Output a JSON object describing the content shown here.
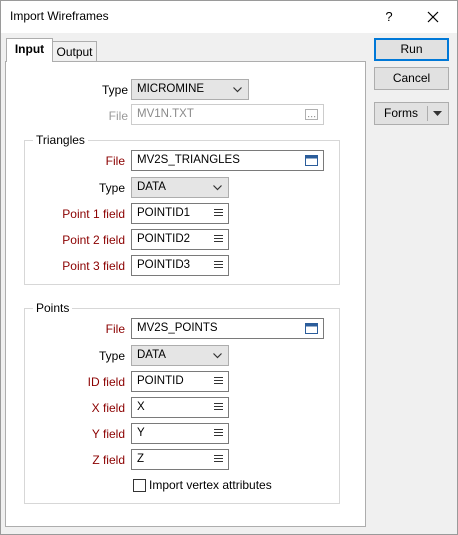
{
  "window": {
    "title": "Import Wireframes",
    "help_label": "?"
  },
  "tabs": [
    {
      "label": "Input",
      "active": true
    },
    {
      "label": "Output",
      "active": false
    }
  ],
  "main": {
    "type_label": "Type",
    "type_value": "MICROMINE",
    "file_label": "File",
    "file_value": "MV1N.TXT"
  },
  "triangles": {
    "title": "Triangles",
    "file_label": "File",
    "file_value": "MV2S_TRIANGLES",
    "type_label": "Type",
    "type_value": "DATA",
    "point1_label": "Point 1 field",
    "point1_value": "POINTID1",
    "point2_label": "Point 2 field",
    "point2_value": "POINTID2",
    "point3_label": "Point 3 field",
    "point3_value": "POINTID3"
  },
  "points": {
    "title": "Points",
    "file_label": "File",
    "file_value": "MV2S_POINTS",
    "type_label": "Type",
    "type_value": "DATA",
    "id_label": "ID field",
    "id_value": "POINTID",
    "x_label": "X field",
    "x_value": "X",
    "y_label": "Y field",
    "y_value": "Y",
    "z_label": "Z field",
    "z_value": "Z",
    "import_attr_label": "Import vertex attributes",
    "import_attr_checked": false
  },
  "buttons": {
    "run": "Run",
    "cancel": "Cancel",
    "forms": "Forms"
  },
  "colors": {
    "required_label": "#8b0000",
    "disabled_label": "#9a9a9a",
    "focus_border": "#0078d7"
  }
}
